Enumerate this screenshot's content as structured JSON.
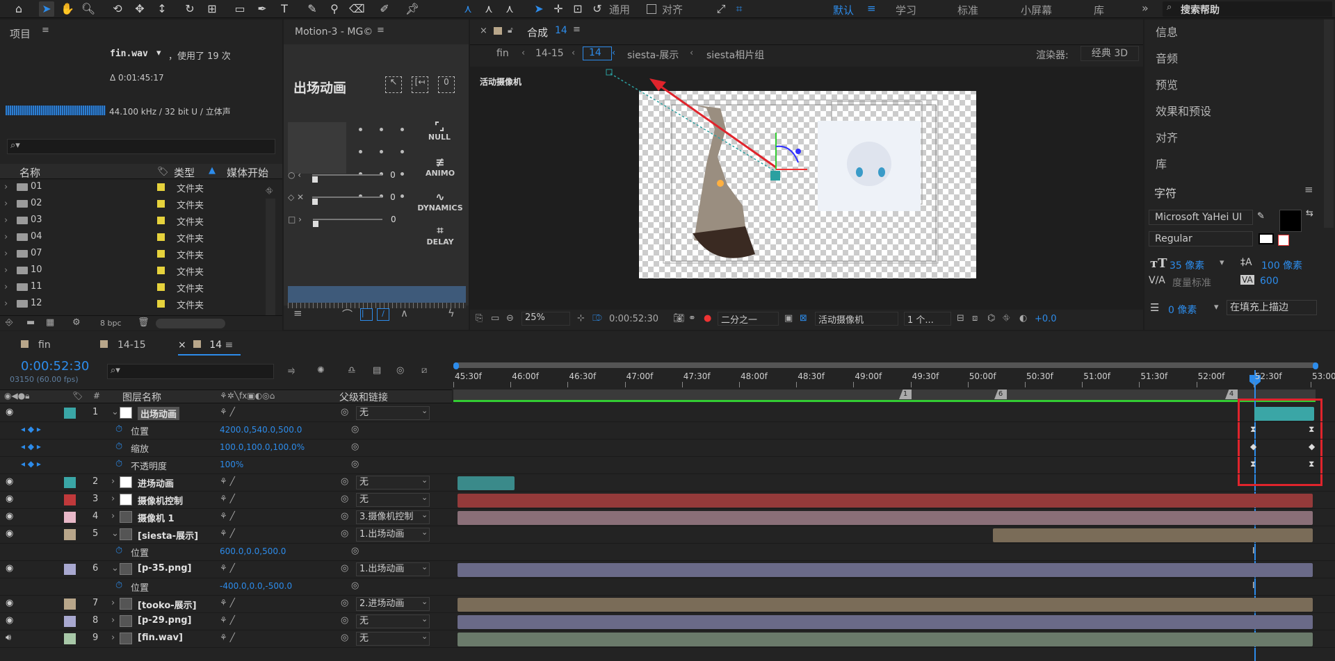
{
  "toolbar": {
    "tools": [
      "home-icon",
      "selection-tool-icon",
      "hand-tool-icon",
      "zoom-tool-icon",
      "orbit-camera-icon",
      "pan-camera-icon",
      "dolly-camera-icon",
      "rotate-tool-icon",
      "pan-behind-icon",
      "rectangle-tool-icon",
      "pen-tool-icon",
      "type-tool-icon",
      "brush-tool-icon",
      "clone-stamp-icon",
      "eraser-icon",
      "roto-brush-icon",
      "puppet-pin-icon"
    ],
    "universal_label": "通用",
    "snap_label": "对齐",
    "workspaces": [
      "默认",
      "学习",
      "标准",
      "小屏幕",
      "库"
    ],
    "active_workspace": "默认",
    "search_help": "搜索帮助"
  },
  "project": {
    "title": "项目",
    "file_name": "fin.wav",
    "usage": "，使用了 19 次",
    "duration": "Δ 0:01:45:17",
    "audio_info": "44.100 kHz / 32 bit U / 立体声",
    "search_placeholder": "",
    "columns": {
      "name": "名称",
      "type": "类型",
      "media_start": "媒体开始"
    },
    "items": [
      {
        "name": "01",
        "type": "文件夹"
      },
      {
        "name": "02",
        "type": "文件夹"
      },
      {
        "name": "03",
        "type": "文件夹"
      },
      {
        "name": "04",
        "type": "文件夹"
      },
      {
        "name": "07",
        "type": "文件夹"
      },
      {
        "name": "10",
        "type": "文件夹"
      },
      {
        "name": "11",
        "type": "文件夹"
      },
      {
        "name": "12",
        "type": "文件夹"
      }
    ],
    "bpc": "8 bpc"
  },
  "motion": {
    "title": "Motion-3 - MG©",
    "heading": "出场动画",
    "null_label": "NULL",
    "animo_label": "ANIMO",
    "dynamics_label": "DYNAMICS",
    "delay_label": "DELAY",
    "slider_values": [
      "0",
      "0",
      "0"
    ]
  },
  "composition": {
    "title": "合成",
    "comp_number": "14",
    "breadcrumbs": [
      "fin",
      "14-15",
      "14",
      "siesta-展示",
      "siesta相片组"
    ],
    "renderer_label": "渲染器:",
    "renderer_value": "经典 3D",
    "camera_label": "活动摄像机",
    "zoom": "25%",
    "timecode": "0:00:52:30",
    "resolution": "二分之一",
    "view": "活动摄像机",
    "views_count": "1 个...",
    "exposure": "+0.0"
  },
  "right_panel": {
    "items": [
      "信息",
      "音频",
      "预览",
      "效果和预设",
      "对齐",
      "库"
    ],
    "char_title": "字符",
    "font_name": "Microsoft YaHei UI",
    "font_style": "Regular",
    "font_size": "35 像素",
    "leading": "100 像素",
    "kerning": "度量标准",
    "tracking": "600",
    "stroke_width": "0 像素",
    "stroke_type": "在填充上描边"
  },
  "timeline": {
    "tabs": [
      "fin",
      "14-15",
      "14"
    ],
    "active_tab": "14",
    "timecode": "0:00:52:30",
    "frame_info": "03150 (60.00 fps)",
    "search_placeholder": "",
    "header_name": "图层名称",
    "header_parent": "父级和链接",
    "ruler": [
      "45:30f",
      "46:00f",
      "46:30f",
      "47:00f",
      "47:30f",
      "48:00f",
      "48:30f",
      "49:00f",
      "49:30f",
      "50:00f",
      "50:30f",
      "51:00f",
      "51:30f",
      "52:00f",
      "52:30f",
      "53:00"
    ],
    "markers": [
      "1",
      "6",
      "4"
    ],
    "layers": [
      {
        "num": "1",
        "name": "出场动画",
        "parent": "无",
        "color": "#3aa6a6"
      },
      {
        "prop": "位置",
        "value": "4200.0,540.0,500.0"
      },
      {
        "prop": "缩放",
        "value": "100.0,100.0,100.0%"
      },
      {
        "prop": "不透明度",
        "value": "100%"
      },
      {
        "num": "2",
        "name": "进场动画",
        "parent": "无",
        "color": "#3aa6a6"
      },
      {
        "num": "3",
        "name": "摄像机控制",
        "parent": "无",
        "color": "#c0393b"
      },
      {
        "num": "4",
        "name": "摄像机 1",
        "parent": "3.摄像机控制",
        "color": "#e8b8c8"
      },
      {
        "num": "5",
        "name": "[siesta-展示]",
        "parent": "1.出场动画",
        "color": "#b8a68a"
      },
      {
        "prop": "位置",
        "value": "600.0,0.0,500.0"
      },
      {
        "num": "6",
        "name": "[p-35.png]",
        "parent": "1.出场动画",
        "color": "#a8a8d0"
      },
      {
        "prop": "位置",
        "value": "-400.0,0.0,-500.0"
      },
      {
        "num": "7",
        "name": "[tooko-展示]",
        "parent": "2.进场动画",
        "color": "#b8a68a"
      },
      {
        "num": "8",
        "name": "[p-29.png]",
        "parent": "无",
        "color": "#a8a8d0"
      },
      {
        "num": "9",
        "name": "[fin.wav]",
        "parent": "无",
        "color": "#a8c8a8"
      }
    ]
  }
}
